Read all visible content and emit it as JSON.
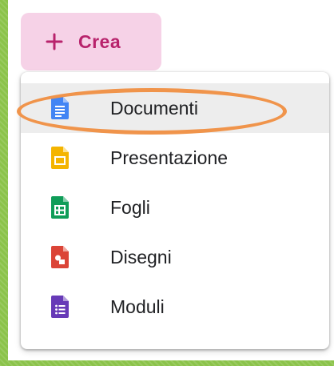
{
  "create_button": {
    "label": "Crea",
    "icon": "plus-icon",
    "color": "#b8236c",
    "background": "#f6d2e7"
  },
  "menu": {
    "items": [
      {
        "label": "Documenti",
        "icon": "google-docs-icon",
        "color": "#4285f4",
        "selected": true
      },
      {
        "label": "Presentazione",
        "icon": "google-slides-icon",
        "color": "#f4b400"
      },
      {
        "label": "Fogli",
        "icon": "google-sheets-icon",
        "color": "#0f9d58"
      },
      {
        "label": "Disegni",
        "icon": "google-drawings-icon",
        "color": "#db4437"
      },
      {
        "label": "Moduli",
        "icon": "google-forms-icon",
        "color": "#673ab7"
      }
    ]
  },
  "annotation": {
    "color": "#f0944b"
  }
}
